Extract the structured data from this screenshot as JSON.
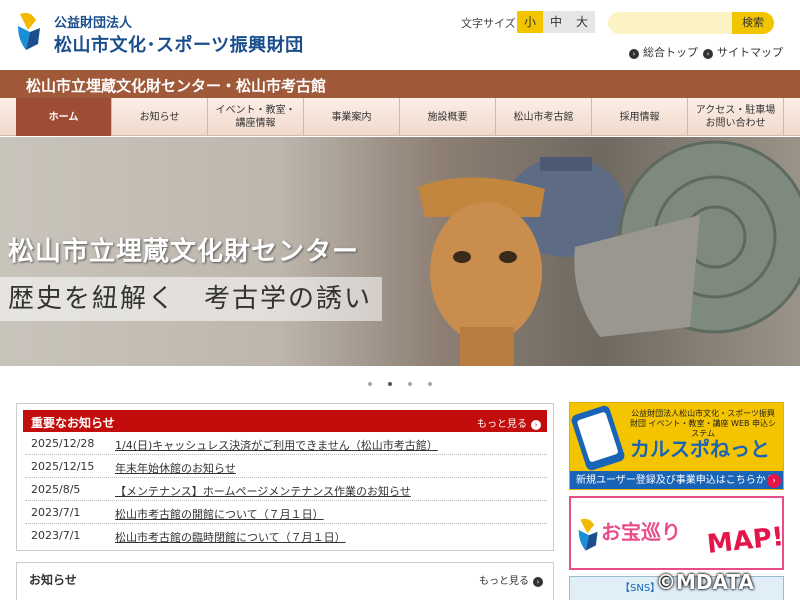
{
  "header": {
    "org_small": "公益財団法人",
    "org_big": "松山市文化･スポーツ振興財団",
    "font_size_label": "文字サイズ",
    "font_sizes": [
      "小",
      "中",
      "大"
    ],
    "search_button": "検索",
    "links": [
      "総合トップ",
      "サイトマップ"
    ]
  },
  "band": {
    "title": "松山市立埋蔵文化財センター・松山市考古館"
  },
  "nav": {
    "items": [
      "ホーム",
      "お知らせ",
      "イベント・教室・講座情報",
      "事業案内",
      "施設概要",
      "松山市考古館",
      "採用情報",
      "アクセス・駐車場 お問い合わせ"
    ]
  },
  "hero": {
    "title": "松山市立埋蔵文化財センター",
    "subtitle": "歴史を紐解く　考古学の誘い"
  },
  "important": {
    "title": "重要なお知らせ",
    "more": "もっと見る",
    "rows": [
      {
        "date": "2025/12/28",
        "text": "1/4(日)キャッシュレス決済がご利用できません（松山市考古館）"
      },
      {
        "date": "2025/12/15",
        "text": "年末年始休館のお知らせ"
      },
      {
        "date": "2025/8/5",
        "text": "【メンテナンス】ホームページメンテナンス作業のお知らせ"
      },
      {
        "date": "2023/7/1",
        "text": "松山市考古館の開館について（７月１日）"
      },
      {
        "date": "2023/7/1",
        "text": "松山市考古館の臨時閉館について（７月１日）"
      }
    ]
  },
  "notices": {
    "title": "お知らせ",
    "more": "もっと見る"
  },
  "banners": {
    "karusupo_small": "公益財団法人松山市文化・スポーツ振興財団 イベント・教室・講座 WEB 申込システム",
    "karusupo_big": "カルスポねっと",
    "karusupo_foot": "新規ユーザー登録及び事業申込はこちらから",
    "otakara": "お宝巡り",
    "map": "MAP!",
    "sns": "【SNS】"
  },
  "watermark": "©MDATA",
  "colors": {
    "brand_blue": "#1b4e8c",
    "band_brown": "#a05a3a",
    "accent_yellow": "#f3c500",
    "important_red": "#c30d0d",
    "pink": "#e84d8a"
  }
}
